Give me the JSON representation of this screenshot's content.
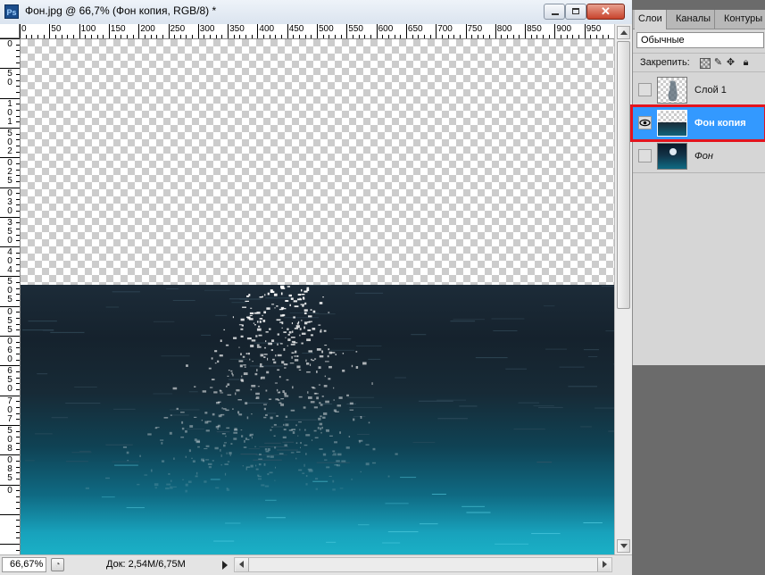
{
  "document": {
    "ps_badge": "Ps",
    "title": "Фон.jpg @ 66,7% (Фон копия, RGB/8) *",
    "window_buttons": {
      "minimize": "",
      "maximize": "",
      "close": "✕"
    }
  },
  "rulers": {
    "top_labels": [
      "0",
      "50",
      "100",
      "150",
      "200",
      "250",
      "300",
      "350",
      "400",
      "450",
      "500",
      "550",
      "600",
      "650",
      "700",
      "750",
      "800",
      "850",
      "900",
      "950"
    ],
    "left_labels": [
      "0",
      "5",
      "0",
      "1",
      "0",
      "1",
      "5",
      "0",
      "2",
      "0",
      "2",
      "5",
      "0",
      "3",
      "0",
      "3",
      "5",
      "0",
      "4",
      "0",
      "4",
      "5",
      "0",
      "5",
      "0",
      "5",
      "5",
      "0",
      "6",
      "0",
      "6",
      "5",
      "0",
      "7",
      "0",
      "7",
      "5",
      "0",
      "8",
      "0",
      "8",
      "5",
      "0"
    ]
  },
  "status": {
    "zoom": "66,67%",
    "doc_info": "Док: 2,54M/6,75M"
  },
  "layers_panel": {
    "tabs": [
      "Слои",
      "Каналы",
      "Контуры"
    ],
    "blend_mode": "Обычные",
    "lock_label": "Закрепить:",
    "layers": [
      {
        "name": "Слой 1",
        "visible": false,
        "selected": false
      },
      {
        "name": "Фон копия",
        "visible": true,
        "selected": true
      },
      {
        "name": "Фон",
        "visible": false,
        "selected": false,
        "italic": true
      }
    ]
  },
  "colors": {
    "selection": "#3399ff",
    "highlight": "#e3141e"
  }
}
